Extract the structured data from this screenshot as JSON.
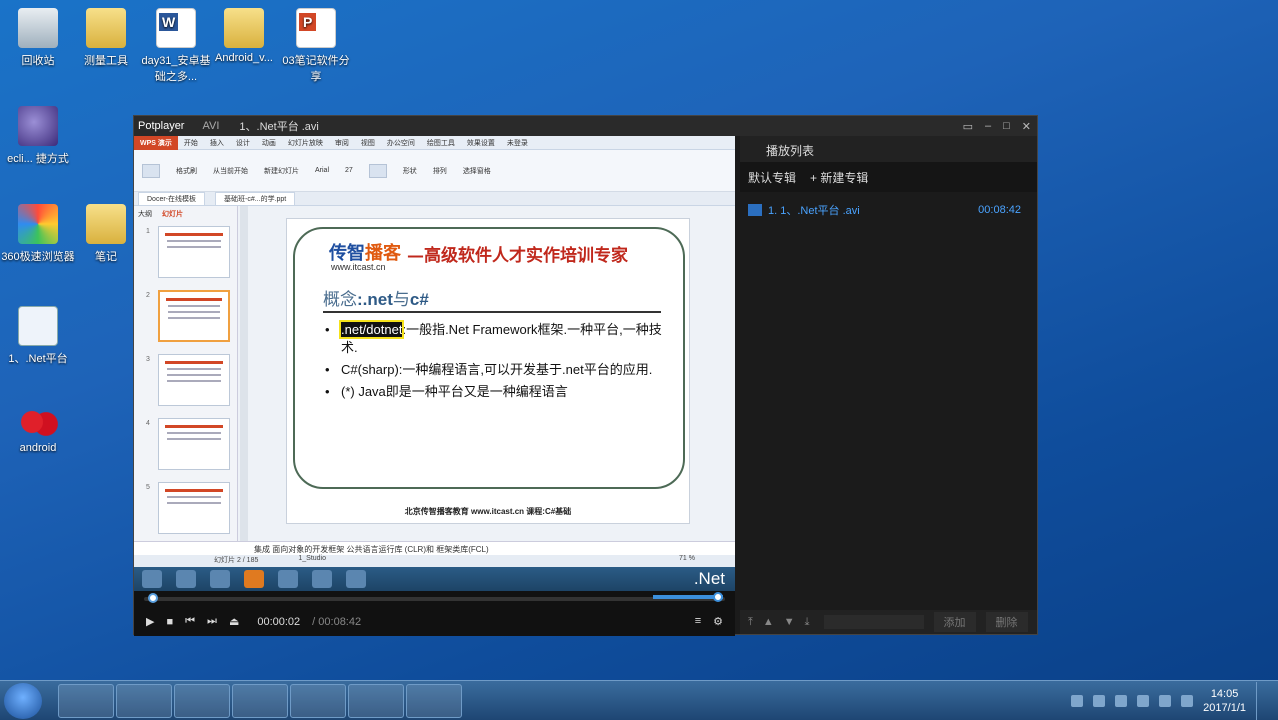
{
  "desktop": {
    "icons": [
      {
        "label": "回收站"
      },
      {
        "label": "测量工具"
      },
      {
        "label": "day31_安卓基础之多..."
      },
      {
        "label": "Android_v..."
      },
      {
        "label": "03笔记软件分享"
      },
      {
        "label": "ecli... 捷方式"
      },
      {
        "label": "360极速浏览器"
      },
      {
        "label": "笔记"
      },
      {
        "label": "1、.Net平台"
      },
      {
        "label": "android"
      }
    ]
  },
  "potplayer": {
    "brand": "Potplayer",
    "format": "AVI",
    "title": "1、.Net平台 .avi",
    "window_buttons": [
      "▭",
      "–",
      "□",
      "✕"
    ],
    "playlist_header": "播放列表",
    "playlist_tabs": [
      "默认专辑",
      "+ 新建专辑"
    ],
    "playlist_item": {
      "name": "1. 1、.Net平台 .avi",
      "duration": "00:08:42"
    },
    "playlist_actions": [
      "添加",
      "删除"
    ],
    "time_current": "00:00:02",
    "time_total": "/ 00:08:42"
  },
  "wps": {
    "app_button": "WPS 演示",
    "menu_tabs": [
      "开始",
      "插入",
      "设计",
      "动画",
      "幻灯片放映",
      "审阅",
      "视图",
      "办公空间",
      "绘图工具",
      "效果设置",
      "未登录"
    ],
    "ribbon": {
      "format_brush": "格式刷",
      "from_current": "从当前开始",
      "new_slide": "新建幻灯片",
      "font": "Arial",
      "size": "27",
      "shape": "形状",
      "arrange": "排列",
      "select_pane": "选择窗格"
    },
    "doc_tabs": [
      "Docer-在线模板",
      "基础班-c#...的学.ppt"
    ],
    "panel_tabs": {
      "outline": "大纲",
      "slides": "幻灯片"
    },
    "slide_numbers": [
      "1",
      "2",
      "3",
      "4",
      "5"
    ],
    "slide": {
      "logo_main": "传智",
      "logo_accent": "播客",
      "logo_url": "www.itcast.cn",
      "tagline": "—高级软件人才实作培训专家",
      "concept_prefix": "概念",
      "concept_bold": ":.net",
      "concept_mid": "与",
      "concept_end": "c#",
      "bullet1_highlight": ".net/dotnet",
      "bullet1_rest": ":一般指.Net Framework框架.一种平台,一种技术.",
      "bullet2": "C#(sharp):一种编程语言,可以开发基于.net平台的应用.",
      "bullet3": "(*) Java即是一种平台又是一种编程语言",
      "footer": "北京传智播客教育 www.itcast.cn     课程:C#基础"
    },
    "notes": "集成 面向对象的开发框架 公共语言运行库 (CLR)和 框架类库(FCL)",
    "status_slide": "幻灯片 2 / 185",
    "status_theme": "1_Studio",
    "status_zoom": "71 %",
    "inner_taskbar_text": ".Net"
  },
  "taskbar": {
    "time": "14:05",
    "date": "2017/1/1"
  }
}
